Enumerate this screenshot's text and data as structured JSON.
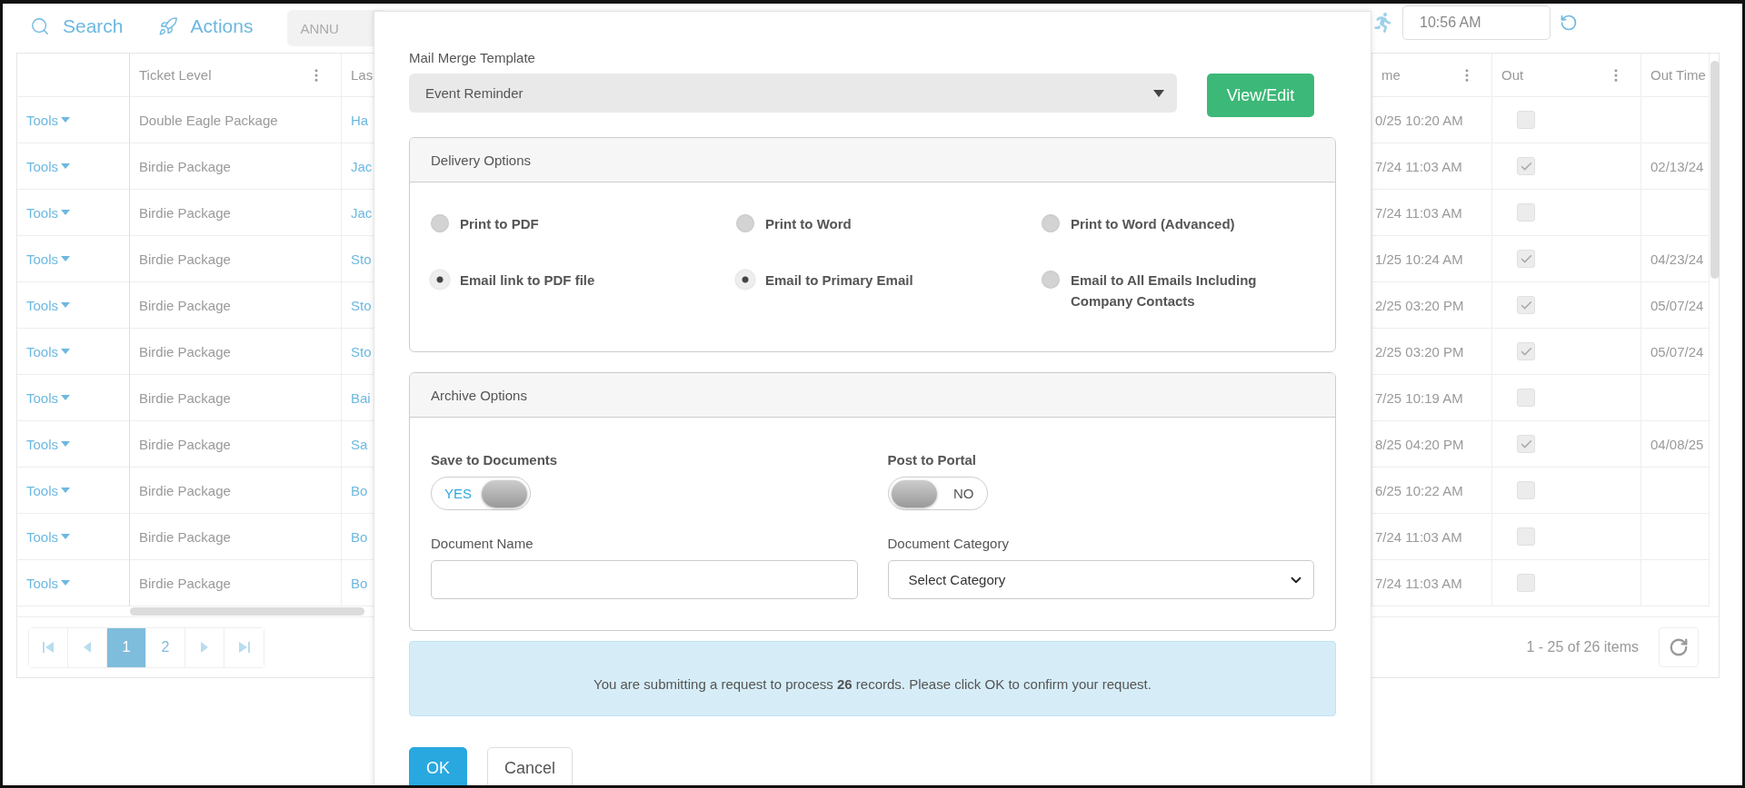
{
  "toolbar": {
    "search": "Search",
    "actions": "Actions",
    "filter_value": "ANNU",
    "time": "10:56 AM"
  },
  "table": {
    "columns_left": [
      "Ticket Level",
      "Las"
    ],
    "columns_right": [
      "me",
      "Out",
      "Out Time"
    ],
    "rows": [
      {
        "tools": "Tools",
        "ticket_level": "Double Eagle Package",
        "column_3": "Ha",
        "column_4": "0/25 10:20 AM",
        "out": false
      },
      {
        "tools": "Tools",
        "ticket_level": "Birdie Package",
        "column_3": "Jac",
        "column_4": "7/24 11:03 AM",
        "out": true,
        "out_time": "02/13/24"
      },
      {
        "tools": "Tools",
        "ticket_level": "Birdie Package",
        "column_3": "Jac",
        "column_4": "7/24 11:03 AM",
        "out": false
      },
      {
        "tools": "Tools",
        "ticket_level": "Birdie Package",
        "column_3": "Sto",
        "column_4": "1/25 10:24 AM",
        "out": true,
        "out_time": "04/23/24"
      },
      {
        "tools": "Tools",
        "ticket_level": "Birdie Package",
        "column_3": "Sto",
        "column_4": "2/25 03:20 PM",
        "out": true,
        "out_time": "05/07/24"
      },
      {
        "tools": "Tools",
        "ticket_level": "Birdie Package",
        "column_3": "Sto",
        "column_4": "2/25 03:20 PM",
        "out": true,
        "out_time": "05/07/24"
      },
      {
        "tools": "Tools",
        "ticket_level": "Birdie Package",
        "column_3": "Bai",
        "column_4": "7/25 10:19 AM",
        "out": false
      },
      {
        "tools": "Tools",
        "ticket_level": "Birdie Package",
        "column_3": "Sa",
        "column_4": "8/25 04:20 PM",
        "out": true,
        "out_time": "04/08/25"
      },
      {
        "tools": "Tools",
        "ticket_level": "Birdie Package",
        "column_3": "Bo",
        "column_4": "6/25 10:22 AM",
        "out": false
      },
      {
        "tools": "Tools",
        "ticket_level": "Birdie Package",
        "column_3": "Bo",
        "column_4": "7/24 11:03 AM",
        "out": false
      },
      {
        "tools": "Tools",
        "ticket_level": "Birdie Package",
        "column_3": "Bo",
        "column_4": "7/24 11:03 AM",
        "out": false
      }
    ]
  },
  "pager": {
    "pages": [
      {
        "label": "1",
        "selected": true
      },
      {
        "label": "2",
        "selected": false
      }
    ],
    "summary": "1 - 25 of 26 items"
  },
  "modal": {
    "template_label": "Mail Merge Template",
    "template_value": "Event Reminder",
    "view_button": "View/Edit",
    "delivery": {
      "title": "Delivery Options",
      "options": [
        {
          "label": "Print to PDF",
          "selected": false
        },
        {
          "label": "Print to Word",
          "selected": false
        },
        {
          "label": "Print to Word (Advanced)",
          "selected": false
        },
        {
          "label": "Email link to PDF file",
          "selected": true
        },
        {
          "label": "Email to Primary Email",
          "selected": true
        },
        {
          "label": "Email to All Emails Including Company Contacts",
          "selected": false
        }
      ]
    },
    "archive": {
      "title": "Archive Options",
      "toggles": [
        {
          "label": "Save to Documents",
          "on": true,
          "text": "YES"
        },
        {
          "label": "Post to Portal",
          "on": false,
          "text": "NO"
        }
      ],
      "fields": [
        {
          "label": "Document Name",
          "kind": "input"
        },
        {
          "label": "Document Category",
          "kind": "select",
          "value": "Select Category"
        }
      ]
    },
    "notice": "You are submitting a request to process **26** records. Please click OK to confirm your request.",
    "buttons": [
      {
        "label": "OK",
        "kind": "primary"
      },
      {
        "label": "Cancel",
        "kind": "secondary"
      }
    ]
  }
}
